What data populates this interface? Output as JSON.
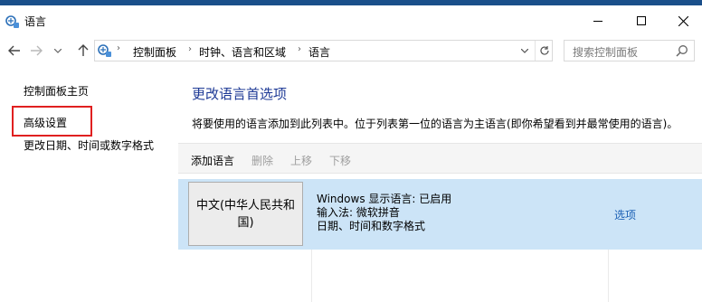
{
  "window": {
    "title": "语言",
    "icon": "control-panel-icon",
    "buttons": [
      "minimize",
      "maximize",
      "close"
    ]
  },
  "navigation": {
    "back_icon": "arrow-left-icon",
    "forward_icon": "arrow-right-icon",
    "history_icon": "chevron-down-icon",
    "up_icon": "arrow-up-icon",
    "breadcrumb": [
      "控制面板",
      "时钟、语言和区域",
      "语言"
    ],
    "search_placeholder": "搜索控制面板"
  },
  "sidebar": {
    "items": [
      {
        "label": "控制面板主页"
      },
      {
        "label": "高级设置",
        "highlighted": true
      },
      {
        "label": "更改日期、时间或数字格式"
      }
    ]
  },
  "main": {
    "heading": "更改语言首选项",
    "description": "将要使用的语言添加到此列表中。位于列表第一位的语言为主语言(即你希望看到并最常使用的语言)。",
    "toolbar": {
      "add": "添加语言",
      "remove": "删除",
      "move_up": "上移",
      "move_down": "下移"
    },
    "languages": [
      {
        "name": "中文(中华人民共和国)",
        "details": [
          "Windows 显示语言: 已启用",
          "输入法: 微软拼音",
          "日期、时间和数字格式"
        ],
        "options_label": "选项"
      }
    ]
  },
  "colors": {
    "link_heading": "#1e3a96",
    "selected_row": "#cce4f7",
    "highlight_box": "#e02020",
    "options_link": "#1a5fb4",
    "disabled_text": "#9e9e9e"
  }
}
